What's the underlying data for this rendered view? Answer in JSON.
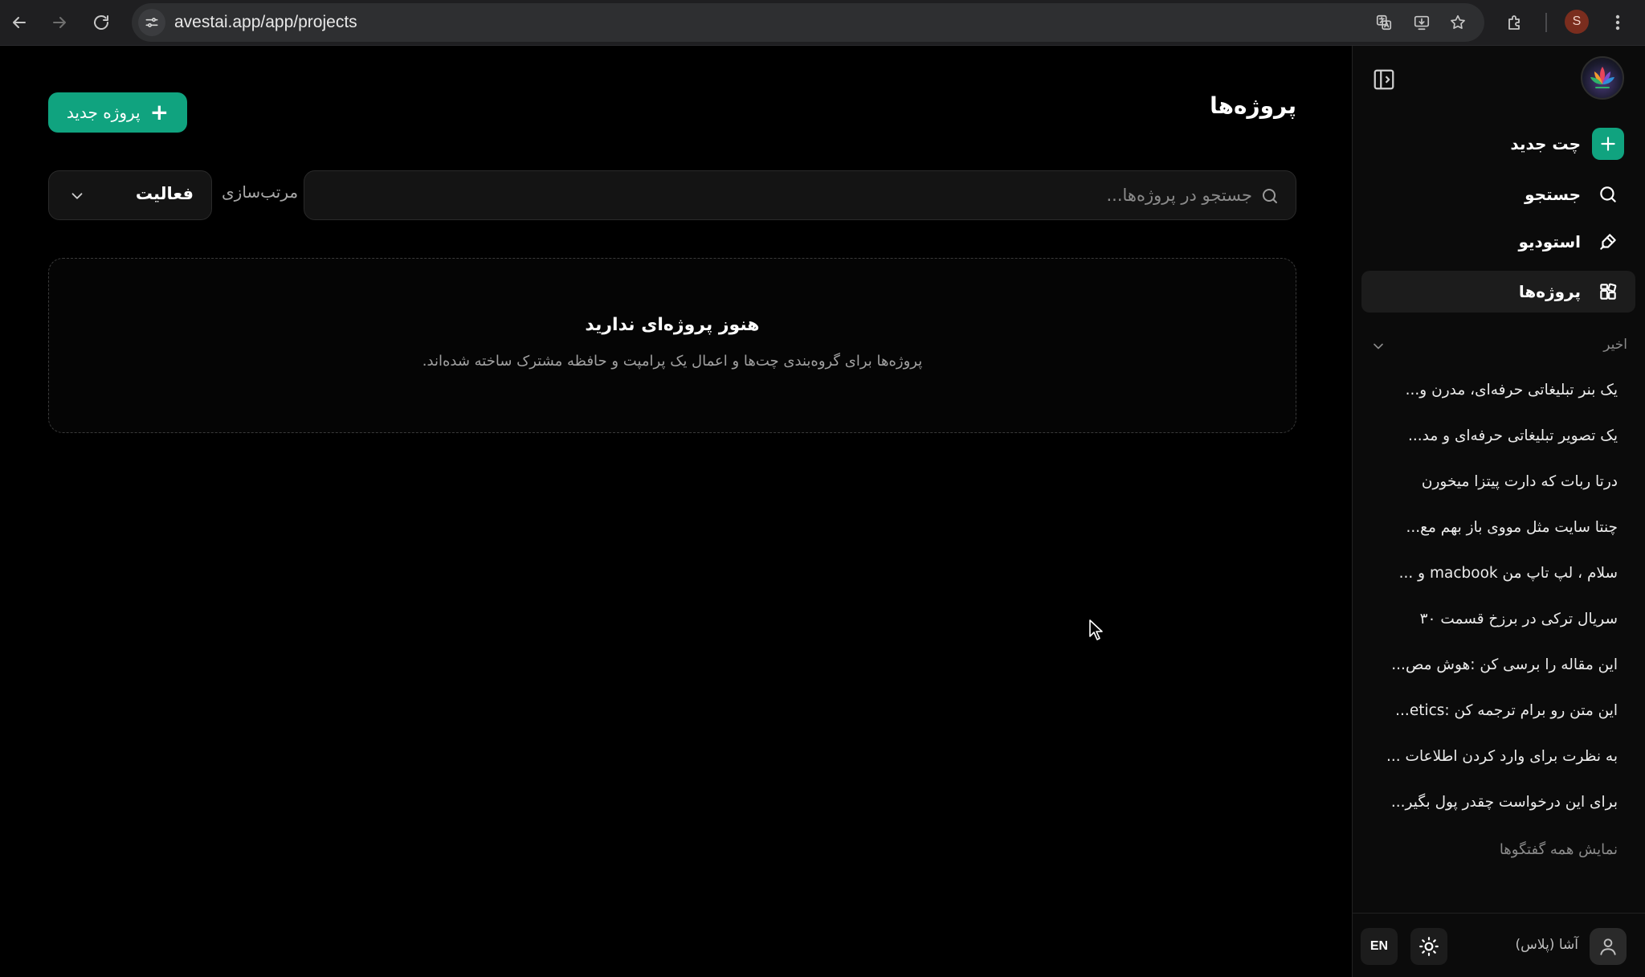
{
  "browser": {
    "url": "avestai.app/app/projects",
    "profile_initial": "S"
  },
  "main": {
    "title": "پروژه‌ها",
    "new_project_label": "پروژه جدید",
    "search_placeholder": "جستجو در پروژه‌ها...",
    "sort_label": "مرتب‌سازی",
    "sort_value": "فعالیت",
    "empty_title": "هنوز پروژه‌ای ندارید",
    "empty_description": "پروژه‌ها برای گروه‌بندی چت‌ها و اعمال یک پرامپت و حافظه مشترک ساخته شده‌اند."
  },
  "sidebar": {
    "nav": [
      {
        "label": "چت جدید",
        "icon": "plus-icon"
      },
      {
        "label": "جستجو",
        "icon": "search-icon"
      },
      {
        "label": "استودیو",
        "icon": "paint-brush-icon"
      },
      {
        "label": "پروژه‌ها",
        "icon": "projects-icon"
      }
    ],
    "recent_heading": "اخیر",
    "recent": [
      "یک بنر تبلیغاتی حرفه‌ای، مدرن و...",
      "یک تصویر تبلیغاتی حرفه‌ای و مد...",
      "درتا ربات که دارت پیتزا میخورن",
      "چنتا سایت مثل مووی باز بهم مع...",
      "سلام ، لپ تاپ من macbook و ...",
      "سریال ترکی در برزخ قسمت ۳۰",
      "این مقاله را برسی کن :هوش مص...",
      "این متن رو برام ترجمه کن :etics...",
      "به نظرت برای وارد کردن اطلاعات ...",
      "برای این درخواست چقدر پول بگیر..."
    ],
    "show_all": "نمایش همه گفتگوها",
    "user_name": "آشا (پلاس)",
    "lang_label": "EN"
  },
  "colors": {
    "accent": "#10a37f",
    "background": "#000000",
    "sidebar_bg": "#0b0b0b"
  }
}
